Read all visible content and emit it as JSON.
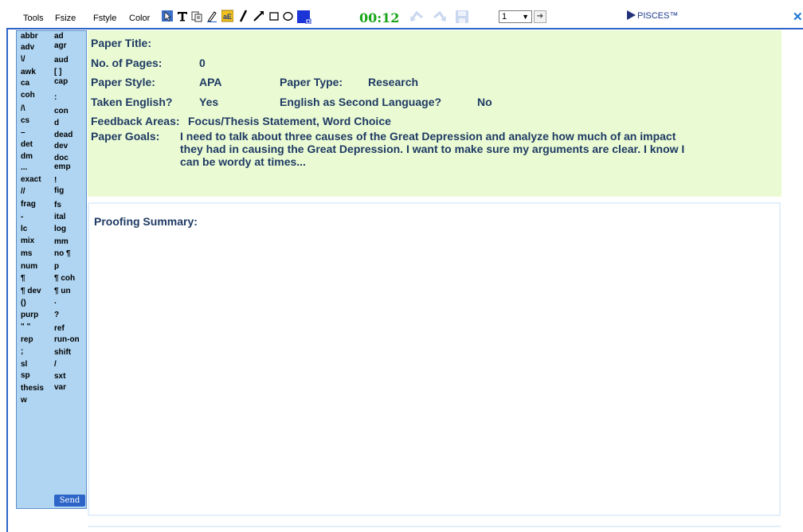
{
  "toolbar": {
    "menus": [
      "Tools",
      "Fsize",
      "Fstyle",
      "Color"
    ],
    "timer": "00:12",
    "page_select": "1",
    "brand": "PISCES™",
    "colors": {
      "accent": "#2c64c8",
      "timer": "#1aa51a",
      "text": "#1f3a63"
    }
  },
  "codes": {
    "left": [
      "abbr",
      "adv",
      "\\/",
      "awk",
      "ca",
      "coh",
      "/\\",
      "cs",
      "–",
      "det",
      "dm",
      "...",
      "exact",
      "//",
      "frag",
      "-",
      "lc",
      "mix",
      "ms",
      "num",
      "¶",
      "¶ dev",
      "()",
      "purp",
      "\" \"",
      "rep",
      ";",
      "sl",
      "sp",
      "thesis",
      "w"
    ],
    "right": [
      "ad",
      "agr",
      "aud",
      "[ ]",
      "cap",
      ":",
      "con",
      "d",
      "dead",
      "dev",
      "doc",
      "emp",
      "!",
      "fig",
      "fs",
      "ital",
      "log",
      "mm",
      "no ¶",
      "p",
      "¶ coh",
      "¶ un",
      ".",
      "?",
      "ref",
      "run-on",
      "shift",
      "/",
      "sxt",
      "var"
    ],
    "send_label": "Send"
  },
  "paper": {
    "title_label": "Paper Title:",
    "title_value": "",
    "pages_label": "No. of Pages:",
    "pages_value": "0",
    "style_label": "Paper Style:",
    "style_value": "APA",
    "type_label": "Paper Type:",
    "type_value": "Research",
    "english_label": "Taken English?",
    "english_value": "Yes",
    "esl_label": "English as Second Language?",
    "esl_value": "No",
    "feedback_label": "Feedback Areas:",
    "feedback_value": "Focus/Thesis Statement, Word Choice",
    "goals_label": "Paper Goals:",
    "goals_value": "I need to talk about three causes of the Great Depression and analyze how much of an impact they had in causing the Great Depression. I want to make sure my arguments are clear. I know I can be wordy at times..."
  },
  "summary": {
    "title": "Proofing Summary:"
  }
}
